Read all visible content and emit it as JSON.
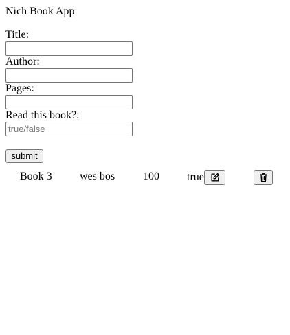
{
  "app": {
    "title": "Nich Book App"
  },
  "form": {
    "title_label": "Title:",
    "title_value": "",
    "author_label": "Author:",
    "author_value": "",
    "pages_label": "Pages:",
    "pages_value": "",
    "read_label": "Read this book?:",
    "read_value": "",
    "read_placeholder": "true/false",
    "submit_label": "submit"
  },
  "books": [
    {
      "title": "Book 3",
      "author": "wes bos",
      "pages": "100",
      "read": "true",
      "edit_icon": "edit-icon",
      "delete_icon": "trash-icon"
    }
  ]
}
